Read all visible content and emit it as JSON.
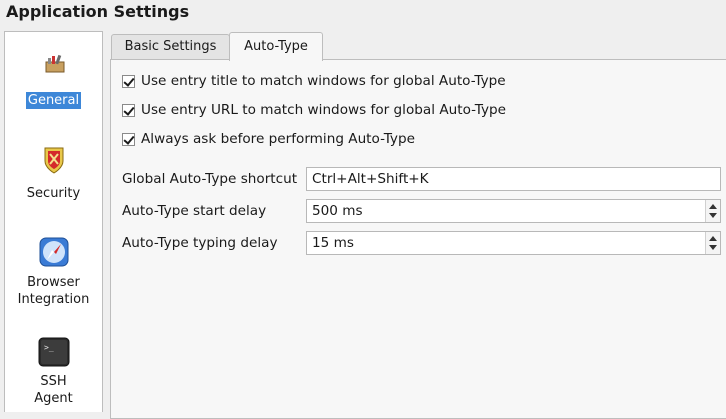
{
  "window": {
    "title": "Application Settings"
  },
  "sidebar": {
    "items": [
      {
        "label": "General",
        "icon": "toolbox-icon",
        "selected": true
      },
      {
        "label": "Security",
        "icon": "shield-icon",
        "selected": false
      },
      {
        "label": "Browser\nIntegration",
        "icon": "compass-icon",
        "selected": false
      },
      {
        "label": "SSH\nAgent",
        "icon": "terminal-icon",
        "selected": false
      }
    ]
  },
  "tabs": [
    {
      "label": "Basic Settings",
      "active": false
    },
    {
      "label": "Auto-Type",
      "active": true
    }
  ],
  "autotype": {
    "checkboxes": [
      {
        "label": "Use entry title to match windows for global Auto-Type",
        "checked": true
      },
      {
        "label": "Use entry URL to match windows for global Auto-Type",
        "checked": true
      },
      {
        "label": "Always ask before performing Auto-Type",
        "checked": true
      }
    ],
    "shortcut": {
      "label": "Global Auto-Type shortcut",
      "value": "Ctrl+Alt+Shift+K"
    },
    "start_delay": {
      "label": "Auto-Type start delay",
      "value": "500 ms"
    },
    "typing_delay": {
      "label": "Auto-Type typing delay",
      "value": "15 ms"
    }
  },
  "colors": {
    "selection": "#3d87d8",
    "panel": "#f7f7f7",
    "window": "#efefef"
  }
}
